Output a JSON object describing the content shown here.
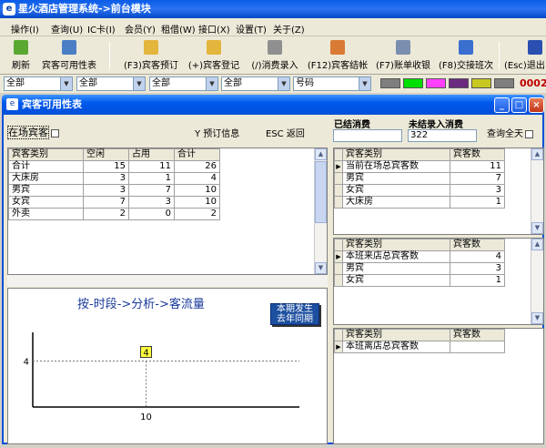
{
  "app": {
    "title": "星火酒店管理系统->前台模块",
    "icon_text": "e"
  },
  "menu": [
    "操作(I)",
    "查询(U)",
    "IC卡(I)",
    "会员(Y)",
    "租借(W)",
    "接口(X)",
    "设置(T)",
    "关于(Z)"
  ],
  "toolbar": [
    {
      "label": "刷新",
      "icon": "refresh-icon",
      "color": "#5aa832"
    },
    {
      "label": "宾客可用性表",
      "icon": "availability-table-icon",
      "color": "#4a7fc6"
    },
    {
      "label": "(F3)宾客预订",
      "icon": "reservation-folder-icon",
      "color": "#e3b53d"
    },
    {
      "label": "(+)宾客登记",
      "icon": "checkin-folder-icon",
      "color": "#e3b53d"
    },
    {
      "label": "(/)消费录入",
      "icon": "scissors-icon",
      "color": "#8f8f8f"
    },
    {
      "label": "(F12)宾客结帐",
      "icon": "checkout-icon",
      "color": "#d97a35"
    },
    {
      "label": "(F7)账单收银",
      "icon": "cash-register-icon",
      "color": "#7a8fb0"
    },
    {
      "label": "(F8)交接班次",
      "icon": "shift-handover-icon",
      "color": "#3a6fd0"
    },
    {
      "label": "(Esc)退出",
      "icon": "exit-icon",
      "color": "#2a4fb0"
    }
  ],
  "filters": [
    "全部",
    "全部",
    "全部",
    "全部",
    "号码"
  ],
  "status_swatches": [
    "#7f7f7f",
    "#00e000",
    "#ff40ff",
    "#6b2a80",
    "#c8c820",
    "#7f7f7f"
  ],
  "status_code": "0002",
  "window": {
    "title": "宾客可用性表",
    "icon_text": "e",
    "min_glyph": "_",
    "max_glyph": "□",
    "close_glyph": "×"
  },
  "controls": {
    "in_house_label": "在场宾客",
    "reserve_info_label": "Y 预订信息",
    "esc_back_label": "ESC 返回",
    "settled_label": "已结消费",
    "settled_value": "",
    "unsettled_label": "未结录入消费",
    "unsettled_value": "322",
    "query_all_day_label": "查询全天"
  },
  "main_table": {
    "headers": [
      "宾客类别",
      "空闲",
      "占用",
      "合计"
    ],
    "rows": [
      [
        "合计",
        "15",
        "11",
        "26"
      ],
      [
        "大床房",
        "3",
        "1",
        "4"
      ],
      [
        "男宾",
        "3",
        "7",
        "10"
      ],
      [
        "女宾",
        "7",
        "3",
        "10"
      ],
      [
        "外卖",
        "2",
        "0",
        "2"
      ]
    ]
  },
  "right_table1": {
    "headers": [
      "宾客类别",
      "宾客数"
    ],
    "rows": [
      [
        "当前在场总宾客数",
        "11"
      ],
      [
        "男宾",
        "7"
      ],
      [
        "女宾",
        "3"
      ],
      [
        "大床房",
        "1"
      ]
    ]
  },
  "right_table2": {
    "headers": [
      "宾客类别",
      "宾客数"
    ],
    "rows": [
      [
        "本班来店总宾客数",
        "4"
      ],
      [
        "男宾",
        "3"
      ],
      [
        "女宾",
        "1"
      ]
    ]
  },
  "right_table3": {
    "headers": [
      "宾客类别",
      "宾客数"
    ],
    "rows": [
      [
        "本班离店总宾客数",
        ""
      ]
    ]
  },
  "chart_panel": {
    "caption": "按-时段->分析->客流量",
    "legend_current": "本期发生",
    "legend_last_year": "去年同期"
  },
  "chart_data": {
    "type": "line",
    "x": [
      10
    ],
    "series": [
      {
        "values": [
          4
        ]
      }
    ],
    "point_labels": [
      "4"
    ],
    "y_tick_labels": [
      "4"
    ],
    "x_tick_labels": [
      "10"
    ],
    "title": "按-时段->分析->客流量",
    "xlabel": "",
    "ylabel": "",
    "grid": false,
    "legend": "top-right"
  }
}
